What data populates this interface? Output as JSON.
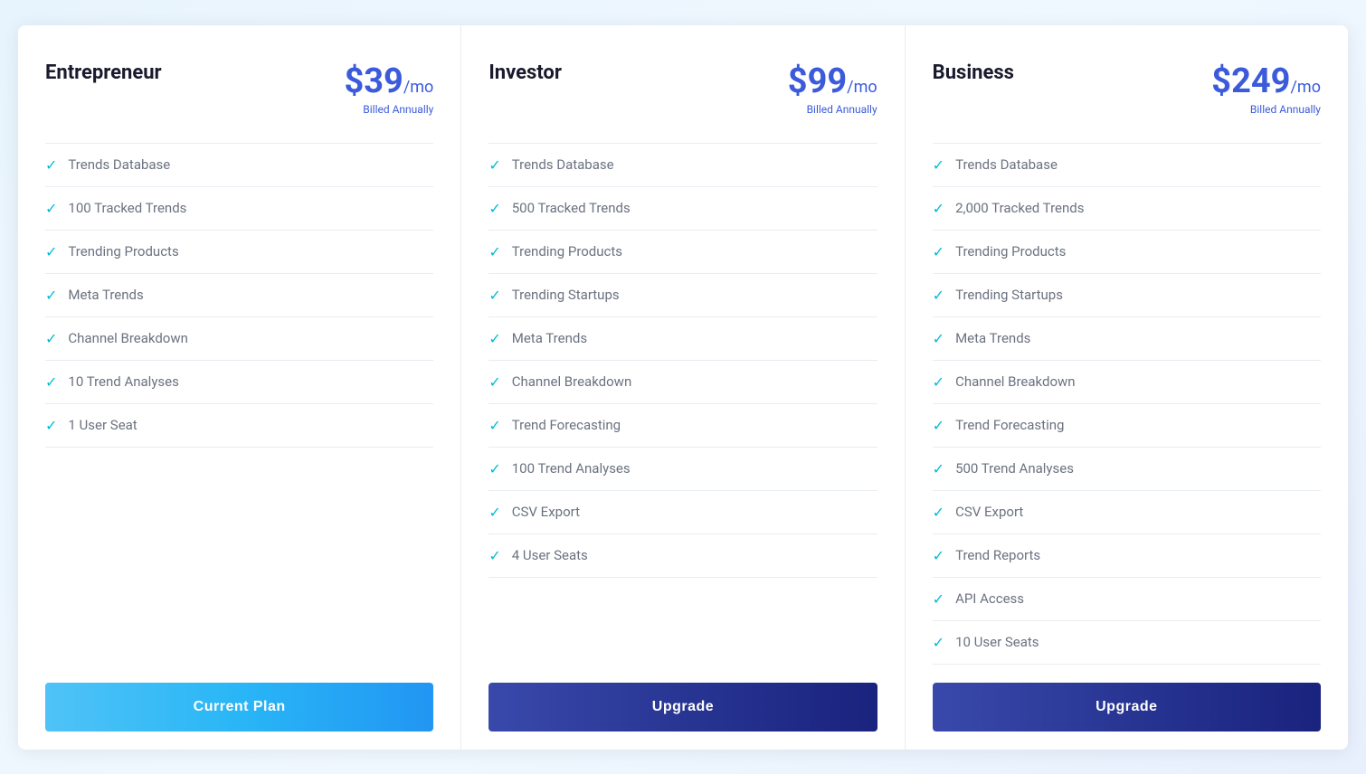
{
  "plans": [
    {
      "id": "entrepreneur",
      "name": "Entrepreneur",
      "price_amount": "$39",
      "price_period": "/mo",
      "billed": "Billed Annually",
      "features": [
        "Trends Database",
        "100 Tracked Trends",
        "Trending Products",
        "Meta Trends",
        "Channel Breakdown",
        "10 Trend Analyses",
        "1 User Seat"
      ],
      "button_label": "Current Plan",
      "button_type": "current"
    },
    {
      "id": "investor",
      "name": "Investor",
      "price_amount": "$99",
      "price_period": "/mo",
      "billed": "Billed Annually",
      "features": [
        "Trends Database",
        "500 Tracked Trends",
        "Trending Products",
        "Trending Startups",
        "Meta Trends",
        "Channel Breakdown",
        "Trend Forecasting",
        "100 Trend Analyses",
        "CSV Export",
        "4 User Seats"
      ],
      "button_label": "Upgrade",
      "button_type": "upgrade"
    },
    {
      "id": "business",
      "name": "Business",
      "price_amount": "$249",
      "price_period": "/mo",
      "billed": "Billed Annually",
      "features": [
        "Trends Database",
        "2,000 Tracked Trends",
        "Trending Products",
        "Trending Startups",
        "Meta Trends",
        "Channel Breakdown",
        "Trend Forecasting",
        "500 Trend Analyses",
        "CSV Export",
        "Trend Reports",
        "API Access",
        "10 User Seats"
      ],
      "button_label": "Upgrade",
      "button_type": "upgrade"
    }
  ]
}
